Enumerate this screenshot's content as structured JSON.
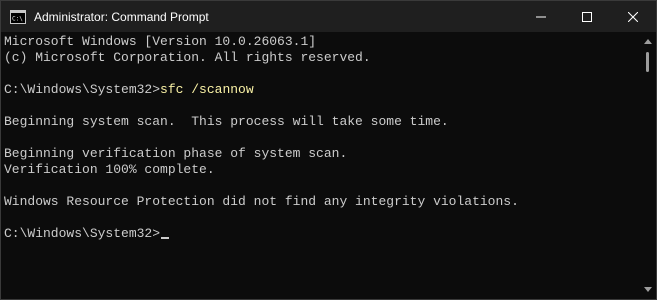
{
  "window": {
    "title": "Administrator: Command Prompt",
    "icon": "cmd-icon",
    "controls": {
      "minimize": "minimize-icon",
      "maximize": "maximize-icon",
      "close": "close-icon"
    }
  },
  "console": {
    "lines": [
      "Microsoft Windows [Version 10.0.26063.1]",
      "(c) Microsoft Corporation. All rights reserved.",
      "",
      "C:\\Windows\\System32>",
      "",
      "Beginning system scan.  This process will take some time.",
      "",
      "Beginning verification phase of system scan.",
      "Verification 100% complete.",
      "",
      "Windows Resource Protection did not find any integrity violations.",
      "",
      "C:\\Windows\\System32>"
    ],
    "command": "sfc /scannow"
  },
  "colors": {
    "background": "#0c0c0c",
    "text": "#cccccc",
    "command": "#f9f1a5",
    "titlebar": "#1f1f1f"
  }
}
